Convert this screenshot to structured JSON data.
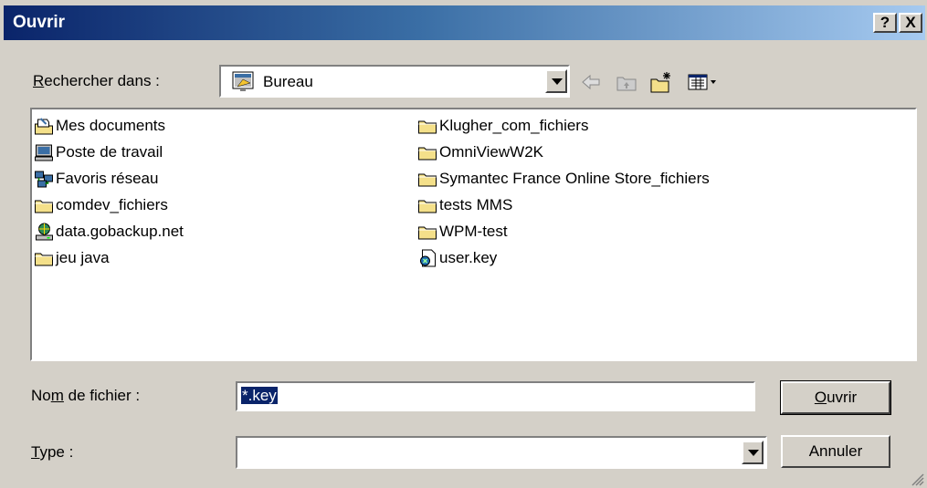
{
  "title": "Ouvrir",
  "titlebar_buttons": {
    "help": "?",
    "close": "X"
  },
  "look_in": {
    "label_mnemonic": "R",
    "label_rest": "echercher dans :",
    "value": "Bureau",
    "icon": "desktop-icon"
  },
  "toolbar": {
    "back": "back-arrow-icon",
    "up": "up-folder-icon",
    "new_folder": "new-folder-icon",
    "views": "view-menu-icon"
  },
  "files": [
    {
      "name": "Mes documents",
      "icon": "my-documents-icon"
    },
    {
      "name": "Poste de travail",
      "icon": "my-computer-icon"
    },
    {
      "name": "Favoris réseau",
      "icon": "network-places-icon"
    },
    {
      "name": "comdev_fichiers",
      "icon": "folder-icon"
    },
    {
      "name": "data.gobackup.net",
      "icon": "network-drive-icon"
    },
    {
      "name": "jeu java",
      "icon": "folder-icon"
    },
    {
      "name": "Klugher_com_fichiers",
      "icon": "folder-icon"
    },
    {
      "name": "OmniViewW2K",
      "icon": "folder-icon"
    },
    {
      "name": "Symantec France Online Store_fichiers",
      "icon": "folder-icon"
    },
    {
      "name": "tests MMS",
      "icon": "folder-icon"
    },
    {
      "name": "WPM-test",
      "icon": "folder-icon"
    },
    {
      "name": "user.key",
      "icon": "key-file-icon"
    }
  ],
  "filename": {
    "label_pre": "No",
    "label_mnemonic": "m",
    "label_post": " de fichier :",
    "value": "*.key"
  },
  "filetype": {
    "label_mnemonic": "T",
    "label_rest": "ype :",
    "value": ""
  },
  "buttons": {
    "open_mnemonic": "O",
    "open_rest": "uvrir",
    "cancel": "Annuler"
  },
  "colors": {
    "titlebar_start": "#0a246a",
    "titlebar_end": "#a6caf0",
    "face": "#d4d0c8",
    "selection": "#0a246a",
    "folder": "#f4e08a"
  }
}
